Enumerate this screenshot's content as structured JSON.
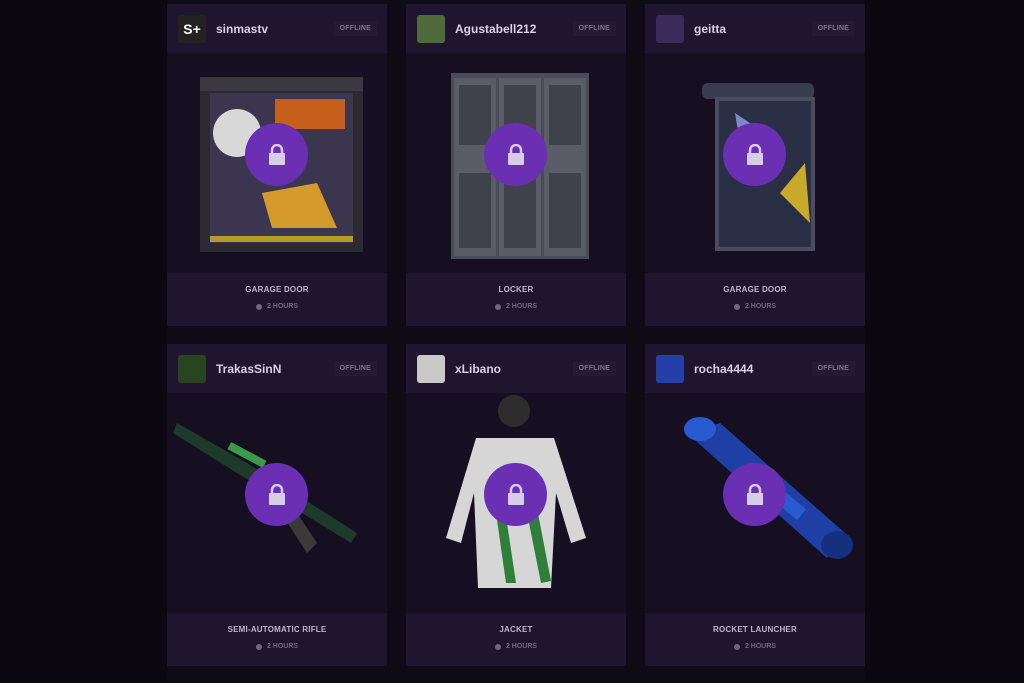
{
  "cards": [
    {
      "streamer": "sinmastv",
      "status": "OFFLINE",
      "item": "GARAGE DOOR",
      "duration": "2 HOURS",
      "avatar_text": "S+",
      "avatar_color": "#222222",
      "lock_icon": "lock-icon"
    },
    {
      "streamer": "Agustabell212",
      "status": "OFFLINE",
      "item": "LOCKER",
      "duration": "2 HOURS",
      "avatar_text": "",
      "avatar_color": "#4f6a3b",
      "lock_icon": "lock-icon"
    },
    {
      "streamer": "geitta",
      "status": "OFFLINE",
      "item": "GARAGE DOOR",
      "duration": "2 HOURS",
      "avatar_text": "",
      "avatar_color": "#3b2a5a",
      "lock_icon": "lock-icon"
    },
    {
      "streamer": "TrakasSinN",
      "status": "OFFLINE",
      "item": "SEMI-AUTOMATIC RIFLE",
      "duration": "2 HOURS",
      "avatar_text": "",
      "avatar_color": "#27451f",
      "lock_icon": "lock-icon"
    },
    {
      "streamer": "xLibano",
      "status": "OFFLINE",
      "item": "JACKET",
      "duration": "2 HOURS",
      "avatar_text": "",
      "avatar_color": "#c9c9c9",
      "lock_icon": "lock-icon"
    },
    {
      "streamer": "rocha4444",
      "status": "OFFLINE",
      "item": "ROCKET LAUNCHER",
      "duration": "2 HOURS",
      "avatar_text": "",
      "avatar_color": "#2440a8",
      "lock_icon": "lock-icon"
    }
  ],
  "accent": "#6a2fb3"
}
